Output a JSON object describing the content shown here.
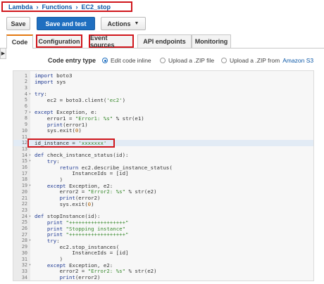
{
  "breadcrumb": [
    "Lambda",
    "Functions",
    "EC2_stop"
  ],
  "toolbar": {
    "save": "Save",
    "save_and_test": "Save and test",
    "actions": "Actions"
  },
  "tabs": [
    "Code",
    "Configuration",
    "Event sources",
    "API endpoints",
    "Monitoring"
  ],
  "code_entry": {
    "label": "Code entry type",
    "options": [
      "Edit code inline",
      "Upload a .ZIP file",
      "Upload a .ZIP from"
    ],
    "s3_link": "Amazon S3",
    "selected": "Edit code inline"
  },
  "code_lines": [
    "import boto3",
    "import sys",
    "",
    "try:",
    "    ec2 = boto3.client('ec2')",
    "",
    "except Exception, e:",
    "    error1 = \"Error1: %s\" % str(e1)",
    "    print(error1)",
    "    sys.exit(0)",
    "",
    "id_instance = 'xxxxxxx'",
    "",
    "def check_instance_status(id):",
    "    try:",
    "        return ec2.describe_instance_status(",
    "            InstanceIds = [id]",
    "        )",
    "    except Exception, e2:",
    "        error2 = \"Error2: %s\" % str(e2)",
    "        print(error2)",
    "        sys.exit(0)",
    "",
    "def stopInstance(id):",
    "    print \"++++++++++++++++++\"",
    "    print \"Stopping instance\"",
    "    print \"++++++++++++++++++\"",
    "    try:",
    "        ec2.stop_instances(",
    "            InstanceIds = [id]",
    "        )",
    "    except Exception, e2:",
    "        error2 = \"Error2: %s\" % str(e2)",
    "        print(error2)"
  ],
  "fold_lines": [
    4,
    7,
    14,
    15,
    19,
    24,
    28,
    32
  ],
  "current_line": 12
}
